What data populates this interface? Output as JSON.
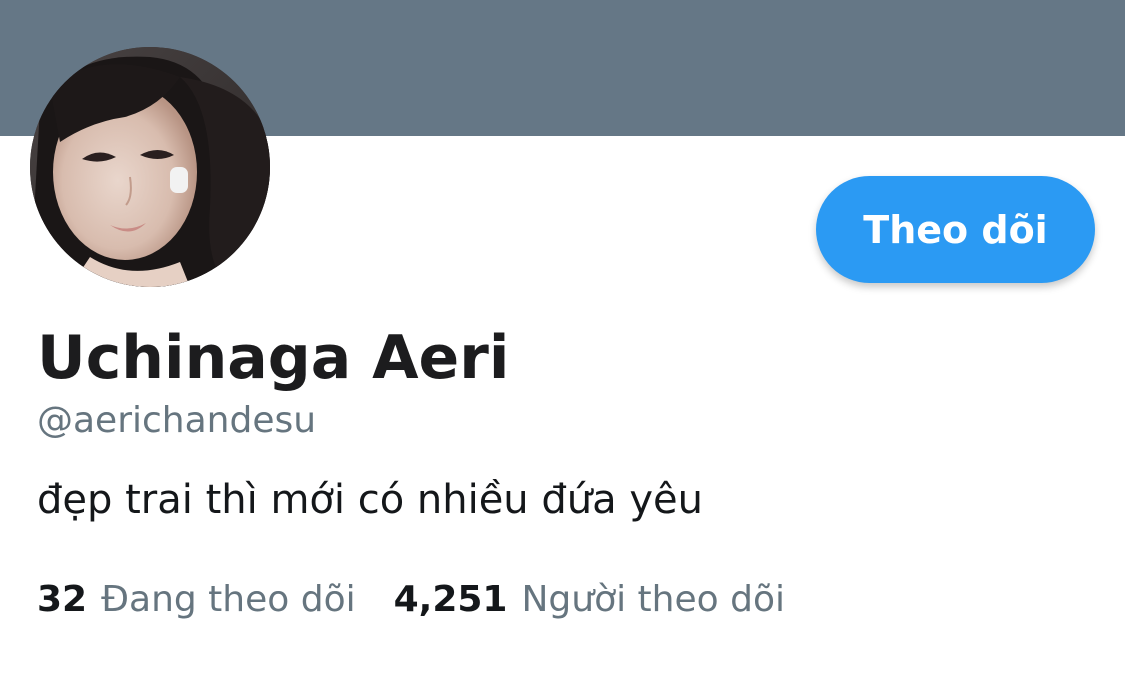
{
  "profile": {
    "display_name": "Uchinaga Aeri",
    "handle": "@aerichandesu",
    "bio": "đẹp trai thì mới có nhiều đứa yêu",
    "follow_button_label": "Theo dõi"
  },
  "stats": {
    "following_count": "32",
    "following_label": "Đang theo dõi",
    "followers_count": "4,251",
    "followers_label": "Người theo dõi"
  },
  "colors": {
    "banner": "#657786",
    "accent": "#2b9af3",
    "secondary_text": "#66757f",
    "primary_text": "#14171a"
  }
}
